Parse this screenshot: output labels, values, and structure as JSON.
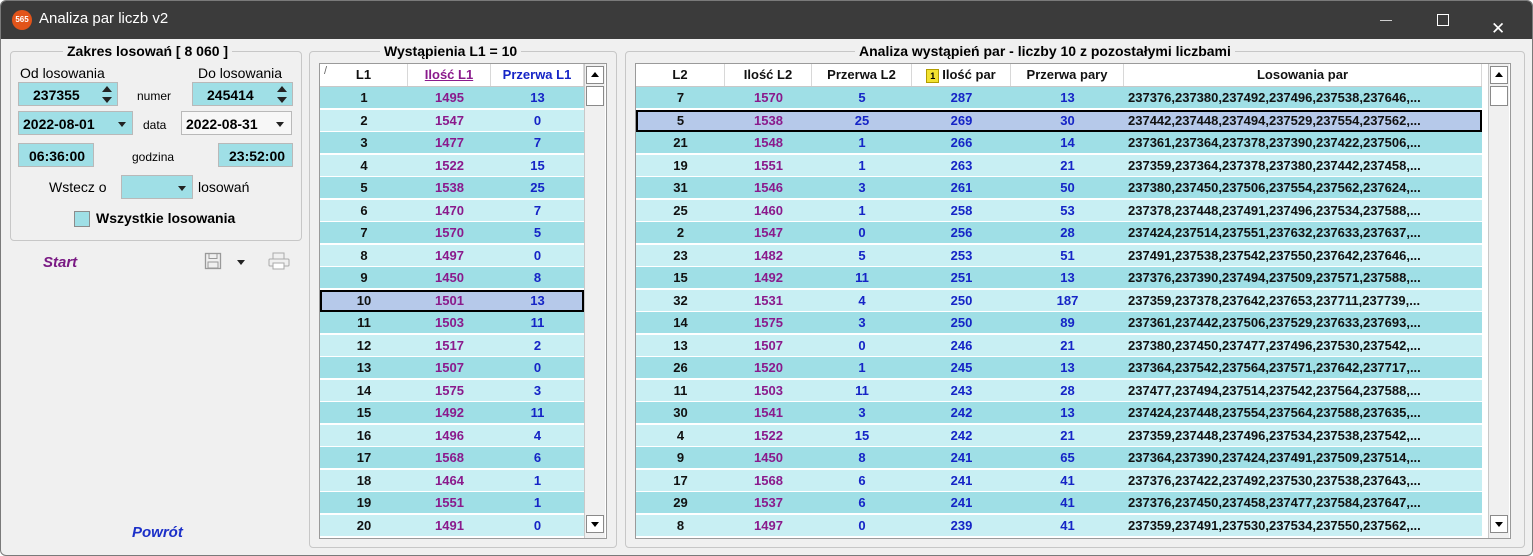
{
  "window": {
    "title": "Analiza par liczb v2",
    "app_icon_text": "565",
    "controls": {
      "minimize": "minimize-icon",
      "maximize": "maximize-icon",
      "close": "close-icon"
    }
  },
  "range_panel": {
    "title": "Zakres losowań  [ 8 060 ]",
    "from_label": "Od losowania",
    "to_label": "Do losowania",
    "number_label": "numer",
    "from_number": "237355",
    "to_number": "245414",
    "date_label": "data",
    "from_date": "2022-08-01",
    "to_date": "2022-08-31",
    "hour_label": "godzina",
    "from_time": "06:36:00",
    "to_time": "23:52:00",
    "back_label": "Wstecz o",
    "back_value": "",
    "back_suffix": "losowań",
    "all_draws_label": "Wszystkie losowania"
  },
  "actions": {
    "start": "Start",
    "back": "Powrót",
    "save_icon": "save-icon",
    "print_icon": "print-icon"
  },
  "colors": {
    "row_even": "#9fdfe6",
    "row_odd": "#c8eff3",
    "selected_row": "#b6c9ea",
    "purple_text": "#8a1a8c",
    "blue_text": "#1524c6"
  },
  "occurrences": {
    "title": "Wystąpienia L1 = 10",
    "sort_marker": "/",
    "columns": [
      "L1",
      "Ilość L1",
      "Przerwa L1"
    ],
    "selected_index": 9,
    "rows": [
      [
        "1",
        "1495",
        "13"
      ],
      [
        "2",
        "1547",
        "0"
      ],
      [
        "3",
        "1477",
        "7"
      ],
      [
        "4",
        "1522",
        "15"
      ],
      [
        "5",
        "1538",
        "25"
      ],
      [
        "6",
        "1470",
        "7"
      ],
      [
        "7",
        "1570",
        "5"
      ],
      [
        "8",
        "1497",
        "0"
      ],
      [
        "9",
        "1450",
        "8"
      ],
      [
        "10",
        "1501",
        "13"
      ],
      [
        "11",
        "1503",
        "11"
      ],
      [
        "12",
        "1517",
        "2"
      ],
      [
        "13",
        "1507",
        "0"
      ],
      [
        "14",
        "1575",
        "3"
      ],
      [
        "15",
        "1492",
        "11"
      ],
      [
        "16",
        "1496",
        "4"
      ],
      [
        "17",
        "1568",
        "6"
      ],
      [
        "18",
        "1464",
        "1"
      ],
      [
        "19",
        "1551",
        "1"
      ],
      [
        "20",
        "1491",
        "0"
      ]
    ]
  },
  "pairs": {
    "title": "Analiza wystąpień par - liczby 10 z pozostałymi liczbami",
    "sort_badge": "1",
    "columns": [
      "L2",
      "Ilość L2",
      "Przerwa L2",
      "Ilość par",
      "Przerwa pary",
      "Losowania par"
    ],
    "selected_index": 1,
    "rows": [
      [
        "7",
        "1570",
        "5",
        "287",
        "13",
        "237376,237380,237492,237496,237538,237646,..."
      ],
      [
        "5",
        "1538",
        "25",
        "269",
        "30",
        "237442,237448,237494,237529,237554,237562,..."
      ],
      [
        "21",
        "1548",
        "1",
        "266",
        "14",
        "237361,237364,237378,237390,237422,237506,..."
      ],
      [
        "19",
        "1551",
        "1",
        "263",
        "21",
        "237359,237364,237378,237380,237442,237458,..."
      ],
      [
        "31",
        "1546",
        "3",
        "261",
        "50",
        "237380,237450,237506,237554,237562,237624,..."
      ],
      [
        "25",
        "1460",
        "1",
        "258",
        "53",
        "237378,237448,237491,237496,237534,237588,..."
      ],
      [
        "2",
        "1547",
        "0",
        "256",
        "28",
        "237424,237514,237551,237632,237633,237637,..."
      ],
      [
        "23",
        "1482",
        "5",
        "253",
        "51",
        "237491,237538,237542,237550,237642,237646,..."
      ],
      [
        "15",
        "1492",
        "11",
        "251",
        "13",
        "237376,237390,237494,237509,237571,237588,..."
      ],
      [
        "32",
        "1531",
        "4",
        "250",
        "187",
        "237359,237378,237642,237653,237711,237739,..."
      ],
      [
        "14",
        "1575",
        "3",
        "250",
        "89",
        "237361,237442,237506,237529,237633,237693,..."
      ],
      [
        "13",
        "1507",
        "0",
        "246",
        "21",
        "237380,237450,237477,237496,237530,237542,..."
      ],
      [
        "26",
        "1520",
        "1",
        "245",
        "13",
        "237364,237542,237564,237571,237642,237717,..."
      ],
      [
        "11",
        "1503",
        "11",
        "243",
        "28",
        "237477,237494,237514,237542,237564,237588,..."
      ],
      [
        "30",
        "1541",
        "3",
        "242",
        "13",
        "237424,237448,237554,237564,237588,237635,..."
      ],
      [
        "4",
        "1522",
        "15",
        "242",
        "21",
        "237359,237448,237496,237534,237538,237542,..."
      ],
      [
        "9",
        "1450",
        "8",
        "241",
        "65",
        "237364,237390,237424,237491,237509,237514,..."
      ],
      [
        "17",
        "1568",
        "6",
        "241",
        "41",
        "237376,237422,237492,237530,237538,237643,..."
      ],
      [
        "29",
        "1537",
        "6",
        "241",
        "41",
        "237376,237450,237458,237477,237584,237647,..."
      ],
      [
        "8",
        "1497",
        "0",
        "239",
        "41",
        "237359,237491,237530,237534,237550,237562,..."
      ]
    ]
  }
}
